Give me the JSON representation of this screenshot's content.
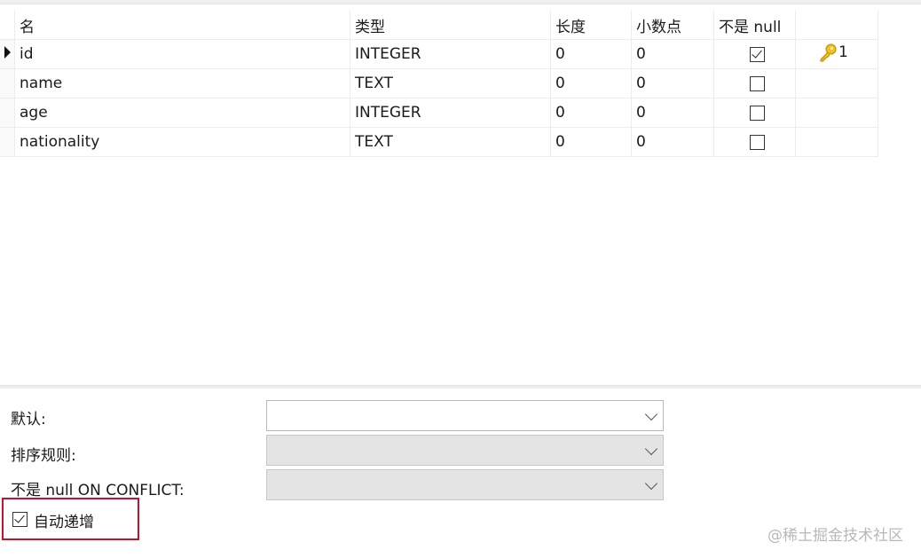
{
  "columns_header": {
    "name": "名",
    "type": "类型",
    "length": "长度",
    "decimals": "小数点",
    "not_null": "不是 null"
  },
  "fields": [
    {
      "name": "id",
      "type": "INTEGER",
      "length": "0",
      "decimals": "0",
      "not_null": true,
      "primary_key": "1",
      "selected": true
    },
    {
      "name": "name",
      "type": "TEXT",
      "length": "0",
      "decimals": "0",
      "not_null": false
    },
    {
      "name": "age",
      "type": "INTEGER",
      "length": "0",
      "decimals": "0",
      "not_null": false
    },
    {
      "name": "nationality",
      "type": "TEXT",
      "length": "0",
      "decimals": "0",
      "not_null": false
    }
  ],
  "properties": {
    "default_label": "默认:",
    "default_value": "",
    "collation_label": "排序规则:",
    "collation_value": "",
    "not_null_conflict_label": "不是 null ON CONFLICT:",
    "not_null_conflict_value": "",
    "autoincrement_label": "自动递增",
    "autoincrement_checked": true
  },
  "watermark": "@稀土掘金技术社区",
  "colors": {
    "highlight_border": "#c8102e",
    "key_icon": "#e8b400"
  }
}
